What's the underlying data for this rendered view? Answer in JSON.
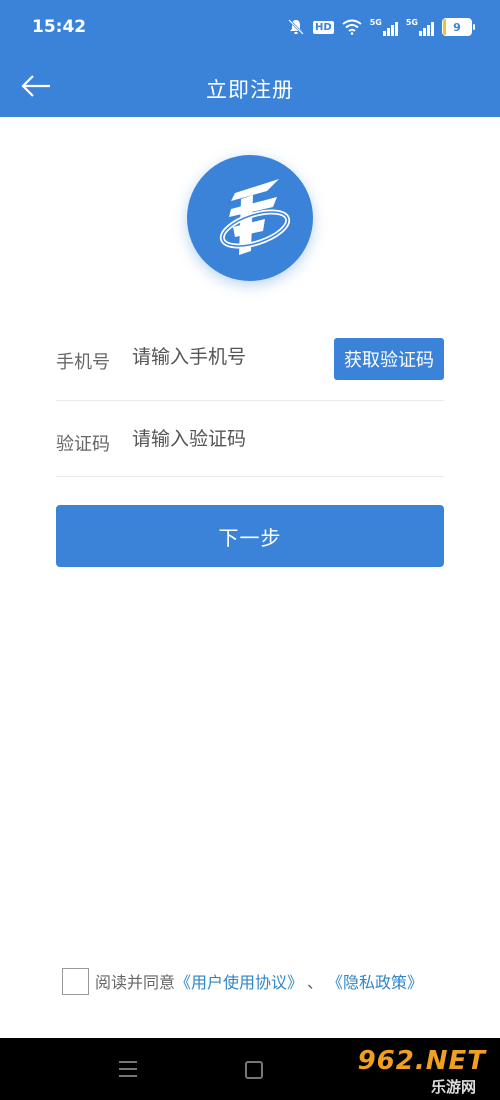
{
  "status_bar": {
    "time": "15:42",
    "battery_level": "9",
    "battery_percent": 9,
    "network_labels": [
      "5G",
      "5G"
    ],
    "hd_label": "HD"
  },
  "header": {
    "title": "立即注册",
    "back_icon": "arrow-left-icon",
    "background_color": "#3a83d8"
  },
  "logo": {
    "icon": "app-logo-icon"
  },
  "form": {
    "phone": {
      "label": "手机号",
      "placeholder": "请输入手机号",
      "value": ""
    },
    "get_code_label": "获取验证码",
    "code": {
      "label": "验证码",
      "placeholder": "请输入验证码",
      "value": ""
    },
    "next_label": "下一步"
  },
  "agreement": {
    "checked": false,
    "prefix": "阅读并同意",
    "user_agreement": "《用户使用协议》",
    "separator": "、",
    "privacy_policy": "《隐私政策》",
    "link_color": "#2f86c8"
  },
  "nav_bar": {
    "menu_icon": "menu-icon",
    "home_icon": "home-square-icon"
  },
  "watermark": {
    "top": "962.NET",
    "bottom": "乐游网"
  }
}
